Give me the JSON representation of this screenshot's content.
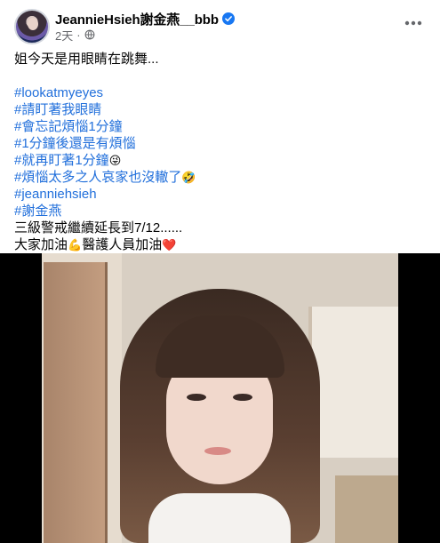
{
  "post": {
    "author": "JeannieHsieh謝金燕__bbb",
    "verified_icon": "verified-badge-icon",
    "time": "2天",
    "separator": "·",
    "audience_icon": "globe-icon",
    "more_icon": "more-horizontal-icon",
    "lines": [
      {
        "text": "姐今天是用眼睛在跳舞...",
        "type": "text"
      },
      {
        "text": "",
        "type": "spacer"
      },
      {
        "text": "#lookatmyeyes",
        "type": "hashtag"
      },
      {
        "text": "#請盯著我眼睛",
        "type": "hashtag"
      },
      {
        "text": "#會忘記煩惱1分鐘",
        "type": "hashtag"
      },
      {
        "text": "#1分鐘後還是有煩惱",
        "type": "hashtag"
      },
      {
        "text": "#就再盯著1分鐘",
        "type": "hashtag",
        "emoji": "😜"
      },
      {
        "text": "#煩惱太多之人哀家也沒轍了",
        "type": "hashtag",
        "emoji": "🤣"
      },
      {
        "text": "#jeanniehsieh",
        "type": "hashtag"
      },
      {
        "text": "#謝金燕",
        "type": "hashtag"
      },
      {
        "text": "三級警戒繼續延長到7/12......",
        "type": "text"
      },
      {
        "text": "大家加油",
        "type": "text",
        "emoji": "💪",
        "text2": "醫護人員加油",
        "emoji2": "❤️"
      }
    ],
    "colors": {
      "hashtag": "#216fdb",
      "meta": "#65676b",
      "verified": "#1877f2"
    }
  }
}
